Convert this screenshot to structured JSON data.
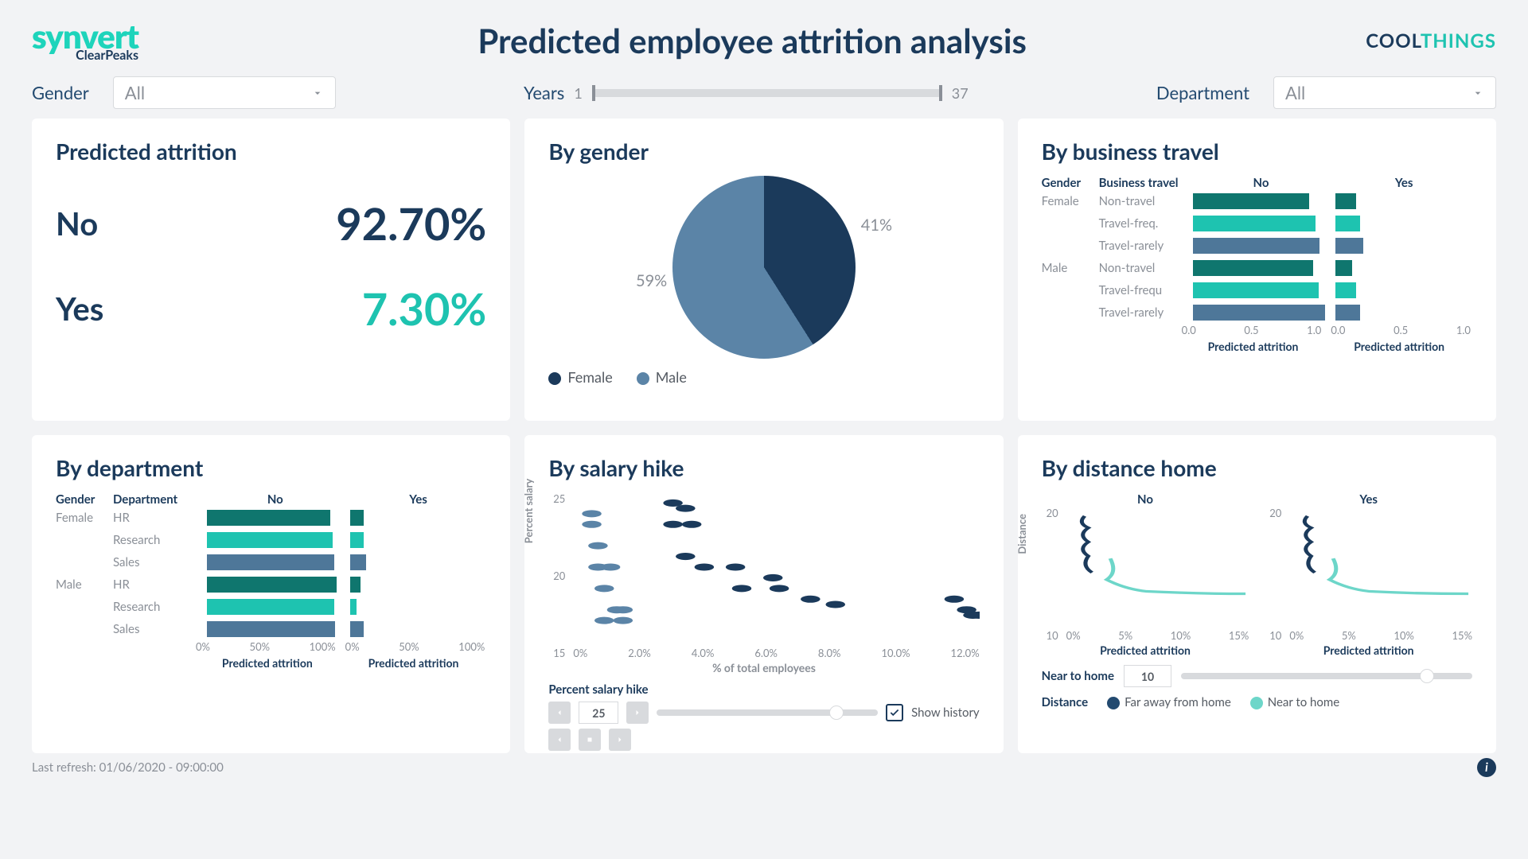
{
  "header": {
    "logo_main": "synvert",
    "logo_sub": "ClearPeaks",
    "title": "Predicted employee attrition analysis",
    "brand_a": "COOL",
    "brand_b": "THINGS"
  },
  "filters": {
    "gender_label": "Gender",
    "gender_value": "All",
    "years_label": "Years",
    "years_min": "1",
    "years_max": "37",
    "department_label": "Department",
    "department_value": "All"
  },
  "kpi": {
    "title": "Predicted attrition",
    "no_label": "No",
    "no_value": "92.70%",
    "yes_label": "Yes",
    "yes_value": "7.30%"
  },
  "pie": {
    "title": "By gender",
    "female_label": "Female",
    "male_label": "Male",
    "female_pct": "41%",
    "male_pct": "59%"
  },
  "travel": {
    "title": "By business travel",
    "h_gender": "Gender",
    "h_cat": "Business travel",
    "h_no": "No",
    "h_yes": "Yes",
    "axis_label": "Predicted attrition",
    "ticks": [
      "0.0",
      "0.5",
      "1.0"
    ],
    "rows": [
      {
        "g": "Female",
        "c": "Non-travel",
        "no": 0.85,
        "yes": 0.15,
        "color": "#0f766e"
      },
      {
        "g": "",
        "c": "Travel-freq.",
        "no": 0.9,
        "yes": 0.18,
        "color": "#1ec3b0"
      },
      {
        "g": "",
        "c": "Travel-rarely",
        "no": 0.93,
        "yes": 0.2,
        "color": "#4e7799"
      },
      {
        "g": "Male",
        "c": "Non-travel",
        "no": 0.88,
        "yes": 0.12,
        "color": "#0f766e"
      },
      {
        "g": "",
        "c": "Travel-frequ",
        "no": 0.92,
        "yes": 0.15,
        "color": "#1ec3b0"
      },
      {
        "g": "",
        "c": "Travel-rarely",
        "no": 0.97,
        "yes": 0.18,
        "color": "#4e7799"
      }
    ]
  },
  "dept": {
    "title": "By department",
    "h_gender": "Gender",
    "h_cat": "Department",
    "h_no": "No",
    "h_yes": "Yes",
    "axis_label": "Predicted attrition",
    "ticks": [
      "0%",
      "50%",
      "100%"
    ],
    "rows": [
      {
        "g": "Female",
        "c": "HR",
        "no": 0.9,
        "yes": 0.1,
        "color": "#0f766e"
      },
      {
        "g": "",
        "c": "Research",
        "no": 0.92,
        "yes": 0.1,
        "color": "#1ec3b0"
      },
      {
        "g": "",
        "c": "Sales",
        "no": 0.93,
        "yes": 0.12,
        "color": "#4e7799"
      },
      {
        "g": "Male",
        "c": "HR",
        "no": 0.95,
        "yes": 0.08,
        "color": "#0f766e"
      },
      {
        "g": "",
        "c": "Research",
        "no": 0.93,
        "yes": 0.05,
        "color": "#1ec3b0"
      },
      {
        "g": "",
        "c": "Sales",
        "no": 0.94,
        "yes": 0.1,
        "color": "#4e7799"
      }
    ]
  },
  "salary": {
    "title": "By salary hike",
    "ylabel": "Percent salary",
    "xlabel": "% of total employees",
    "yticks": [
      "25",
      "20",
      "15"
    ],
    "xticks": [
      "0%",
      "2.0%",
      "4.0%",
      "6.0%",
      "8.0%",
      "10.0%",
      "12.0%"
    ],
    "ctrl_label": "Percent salary hike",
    "ctrl_value": "25",
    "show_history": "Show history"
  },
  "distance": {
    "title": "By distance home",
    "h_no": "No",
    "h_yes": "Yes",
    "ylabel": "Distance",
    "yticks": [
      "20",
      "10"
    ],
    "xticks": [
      "0%",
      "5%",
      "10%",
      "15%"
    ],
    "axis_label": "Predicted attrition",
    "near_label": "Near to home",
    "near_value": "10",
    "legend_title": "Distance",
    "legend_far": "Far away from home",
    "legend_near": "Near to home"
  },
  "footer": {
    "refresh": "Last refresh: 01/06/2020 - 09:00:00"
  },
  "colors": {
    "navy": "#1b3a5b",
    "teal": "#1ec3b0",
    "steel": "#5b84a7",
    "dark_teal": "#0f766e",
    "light_teal": "#6dd6c9"
  },
  "chart_data": [
    {
      "type": "table",
      "title": "Predicted attrition",
      "categories": [
        "No",
        "Yes"
      ],
      "values": [
        92.7,
        7.3
      ]
    },
    {
      "type": "pie",
      "title": "By gender",
      "categories": [
        "Female",
        "Male"
      ],
      "values": [
        41,
        59
      ]
    },
    {
      "type": "bar",
      "title": "By business travel",
      "xlabel": "Predicted attrition",
      "facets": [
        "No",
        "Yes"
      ],
      "categories": [
        "Female / Non-travel",
        "Female / Travel-freq.",
        "Female / Travel-rarely",
        "Male / Non-travel",
        "Male / Travel-frequ",
        "Male / Travel-rarely"
      ],
      "series": [
        {
          "name": "No",
          "values": [
            0.85,
            0.9,
            0.93,
            0.88,
            0.92,
            0.97
          ]
        },
        {
          "name": "Yes",
          "values": [
            0.15,
            0.18,
            0.2,
            0.12,
            0.15,
            0.18
          ]
        }
      ],
      "xlim": [
        0.0,
        1.0
      ]
    },
    {
      "type": "bar",
      "title": "By department",
      "xlabel": "Predicted attrition",
      "facets": [
        "No",
        "Yes"
      ],
      "categories": [
        "Female / HR",
        "Female / Research",
        "Female / Sales",
        "Male / HR",
        "Male / Research",
        "Male / Sales"
      ],
      "series": [
        {
          "name": "No",
          "values": [
            90,
            92,
            93,
            95,
            93,
            94
          ]
        },
        {
          "name": "Yes",
          "values": [
            10,
            10,
            12,
            8,
            5,
            10
          ]
        }
      ],
      "xlim": [
        0,
        100
      ]
    },
    {
      "type": "scatter",
      "title": "By salary hike",
      "xlabel": "% of total employees",
      "ylabel": "Percent salary",
      "xlim": [
        0,
        13
      ],
      "ylim": [
        12,
        26
      ],
      "series": [
        {
          "name": "Male",
          "color": "#5b84a7",
          "points": [
            [
              0.6,
              24
            ],
            [
              0.6,
              23
            ],
            [
              0.8,
              21
            ],
            [
              0.8,
              19
            ],
            [
              1.2,
              19
            ],
            [
              1.0,
              17
            ],
            [
              1.4,
              15
            ],
            [
              1.6,
              15
            ],
            [
              1.0,
              14
            ],
            [
              1.6,
              14
            ]
          ]
        },
        {
          "name": "Female",
          "color": "#1b3a5b",
          "points": [
            [
              3.2,
              25
            ],
            [
              3.6,
              24.5
            ],
            [
              3.2,
              23
            ],
            [
              3.8,
              23
            ],
            [
              3.6,
              20
            ],
            [
              4.2,
              19
            ],
            [
              5.2,
              19
            ],
            [
              5.4,
              17
            ],
            [
              6.4,
              18
            ],
            [
              6.6,
              17
            ],
            [
              7.6,
              16
            ],
            [
              8.4,
              15.5
            ],
            [
              12.2,
              16
            ],
            [
              12.6,
              15
            ],
            [
              12.8,
              14.5
            ],
            [
              13.0,
              14.5
            ]
          ]
        }
      ]
    },
    {
      "type": "line",
      "title": "By distance home",
      "xlabel": "Predicted attrition",
      "ylabel": "Distance",
      "facets": [
        "No",
        "Yes"
      ],
      "xlim": [
        0,
        17
      ],
      "ylim": [
        0,
        28
      ],
      "series": [
        {
          "name": "Far away from home",
          "color": "#234a70"
        },
        {
          "name": "Near to home",
          "color": "#6dd6c9"
        }
      ]
    }
  ]
}
